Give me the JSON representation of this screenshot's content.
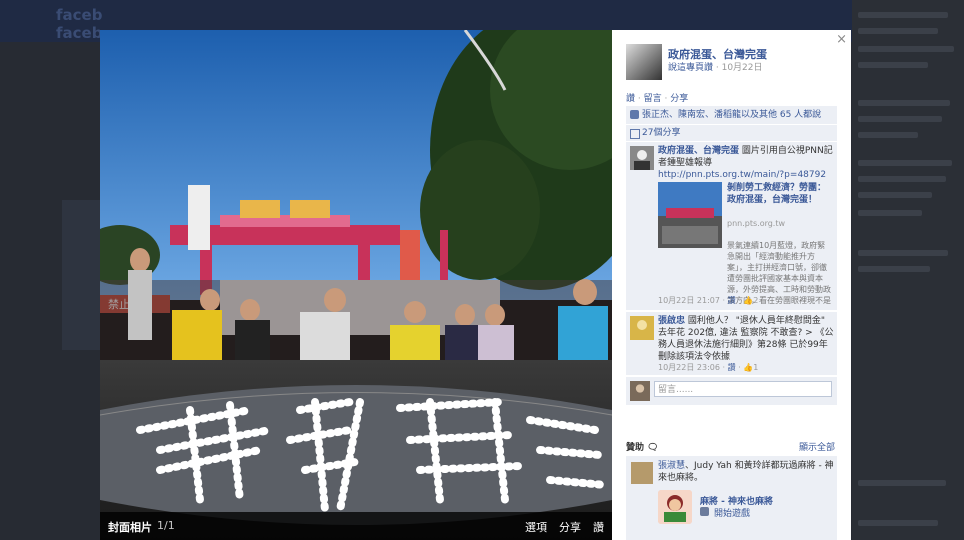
{
  "bg": {
    "logo": "faceb\nfaceb"
  },
  "photo": {
    "album_title": "封面相片",
    "count": "1/1",
    "actions": [
      "選項",
      "分享",
      "讚"
    ],
    "banner_left": "禁止停車",
    "egg_text": "廢死"
  },
  "post": {
    "author": "政府混蛋、台灣完蛋",
    "meta_by": "說這專頁讚",
    "meta_date": "10月22日",
    "actions": [
      "讚",
      "留言",
      "分享"
    ],
    "likes_text": "張正杰、陳南宏、潘稻龍以及其他 65 人都說讚。",
    "shares": "27個分享",
    "close": "×"
  },
  "comments": [
    {
      "name": "政府混蛋、台灣完蛋",
      "text": " 圖片引用自公視PNN記者鍾聖雄報導",
      "link": "http://pnn.pts.org.tw/main/?p=48792",
      "link_title": "剝削勞工救經濟？勞團：政府混蛋，台灣完蛋！",
      "link_domain": "pnn.pts.org.tw",
      "link_desc": "景氣連續10月藍燈，政府緊急開出「經濟動能推升方案」，主打拼經濟口號，卻徹遭勞團批評國家基本與資本源，外勞提高、工時和勞動政策方向，看在勞團眼裡現不是這樣，... 團體工轉、...",
      "more": "更多",
      "time": "10月22日 21:07",
      "like_label": "讚",
      "likes": "2"
    },
    {
      "name": "張啟忠",
      "text": " 國利他人？ \"退休人員年終慰問金\" 去年花 202億, 違法 監察院 不敢查? > 《公務人員退休法施行細則》第28條 已於99年刪除該項法令依據",
      "time": "10月22日 23:06",
      "like_label": "讚",
      "likes": "1"
    }
  ],
  "comment_input": {
    "placeholder": "留言......"
  },
  "ticker": {
    "heading": "贊助 ",
    "see_all": "顯示全部",
    "story_name": "張淑慧",
    "story_with": "、Judy Yah 和黃玲詳都玩過麻將 - 神來也麻將。",
    "game_title": "麻將 - 神來也麻將",
    "game_start": "開始遊戲"
  },
  "colors": {
    "link": "#3b5998",
    "panel_bg": "#eceff5",
    "sky": "#2e72b8"
  }
}
